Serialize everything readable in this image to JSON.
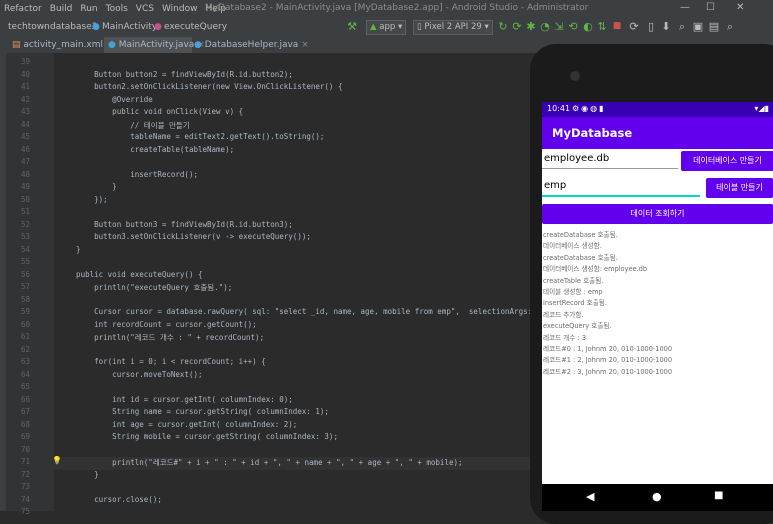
{
  "menu": {
    "items": [
      "Refactor",
      "Build",
      "Run",
      "Tools",
      "VCS",
      "Window",
      "Help"
    ],
    "window_title": "MyDatabase2 - MainActivity.java [MyDatabase2.app] - Android Studio - Administrator",
    "minimize": "—",
    "maximize": "☐",
    "close": "✕"
  },
  "breadcrumb": [
    "techtown",
    "database2",
    "MainActivity",
    "executeQuery"
  ],
  "toolbar": {
    "run_config": "app",
    "device": "Pixel 2 API 29"
  },
  "tabs": [
    {
      "label": "activity_main.xml"
    },
    {
      "label": "MainActivity.java"
    },
    {
      "label": "DatabaseHelper.java"
    }
  ],
  "code": {
    "current_line": "71",
    "lines": [
      {
        "n": "39",
        "t": ""
      },
      {
        "n": "40",
        "t": "        Button button2 = findViewById(R.id.button2);"
      },
      {
        "n": "41",
        "t": "        button2.setOnClickListener(new View.OnClickListener() {"
      },
      {
        "n": "42",
        "t": "            @Override"
      },
      {
        "n": "43",
        "t": "            public void onClick(View v) {"
      },
      {
        "n": "44",
        "t": "                // 테이블 만들기"
      },
      {
        "n": "45",
        "t": "                tableName = editText2.getText().toString();"
      },
      {
        "n": "46",
        "t": "                createTable(tableName);"
      },
      {
        "n": "47",
        "t": ""
      },
      {
        "n": "48",
        "t": "                insertRecord();"
      },
      {
        "n": "49",
        "t": "            }"
      },
      {
        "n": "50",
        "t": "        });"
      },
      {
        "n": "51",
        "t": ""
      },
      {
        "n": "52",
        "t": "        Button button3 = findViewById(R.id.button3);"
      },
      {
        "n": "53",
        "t": "        button3.setOnClickListener(v -> executeQuery());"
      },
      {
        "n": "54",
        "t": "    }"
      },
      {
        "n": "55",
        "t": ""
      },
      {
        "n": "56",
        "t": "    public void executeQuery() {"
      },
      {
        "n": "57",
        "t": "        println(\"executeQuery 호출됨.\");"
      },
      {
        "n": "58",
        "t": ""
      },
      {
        "n": "59",
        "t": "        Cursor cursor = database.rawQuery( sql: \"select _id, name, age, mobile from emp\",  selectionArgs: null);"
      },
      {
        "n": "60",
        "t": "        int recordCount = cursor.getCount();"
      },
      {
        "n": "61",
        "t": "        println(\"레코드 개수 : \" + recordCount);"
      },
      {
        "n": "62",
        "t": ""
      },
      {
        "n": "63",
        "t": "        for(int i = 0; i < recordCount; i++) {"
      },
      {
        "n": "64",
        "t": "            cursor.moveToNext();"
      },
      {
        "n": "65",
        "t": ""
      },
      {
        "n": "66",
        "t": "            int id = cursor.getInt( columnIndex: 0);"
      },
      {
        "n": "67",
        "t": "            String name = cursor.getString( columnIndex: 1);"
      },
      {
        "n": "68",
        "t": "            int age = cursor.getInt( columnIndex: 2);"
      },
      {
        "n": "69",
        "t": "            String mobile = cursor.getString( columnIndex: 3);"
      },
      {
        "n": "70",
        "t": ""
      },
      {
        "n": "71",
        "t": "            println(\"레코드#\" + i + \" : \" + id + \", \" + name + \", \" + age + \", \" + mobile);"
      },
      {
        "n": "72",
        "t": "        }"
      },
      {
        "n": "73",
        "t": ""
      },
      {
        "n": "74",
        "t": "        cursor.close();"
      },
      {
        "n": "75",
        "t": ""
      }
    ]
  },
  "emulator": {
    "status_time": "10:41",
    "status_icons": "▾◢▮",
    "app_title": "MyDatabase",
    "db_input_value": "employee.db",
    "create_db_button": "데이터베이스 만들기",
    "table_input_value": "emp",
    "create_table_button": "테이블 만들기",
    "query_button": "데이터 조회하기",
    "log": [
      "createDatabase 호출됨.",
      "데이터베이스 생성함.",
      "createDatabase 호출됨.",
      "데이터베이스 생성함: employee.db",
      "createTable 호출됨.",
      "테이블 생성함 : emp",
      "insertRecord 호출됨.",
      "레코드 추가함.",
      "executeQuery 호출됨.",
      "레코드 개수 : 3",
      "레코드#0 : 1, Johnm 20, 010-1000-1000",
      "레코드#1 : 2, Johnm 20, 010-1000-1000",
      "레코드#2 : 3, Johnm 20, 010-1000-1000"
    ],
    "nav_back": "◀",
    "nav_home": "●",
    "nav_recents": "■"
  },
  "colors": {
    "accent": "#6200ee",
    "status": "#3700b3",
    "editor_bg": "#2b2b2b"
  }
}
